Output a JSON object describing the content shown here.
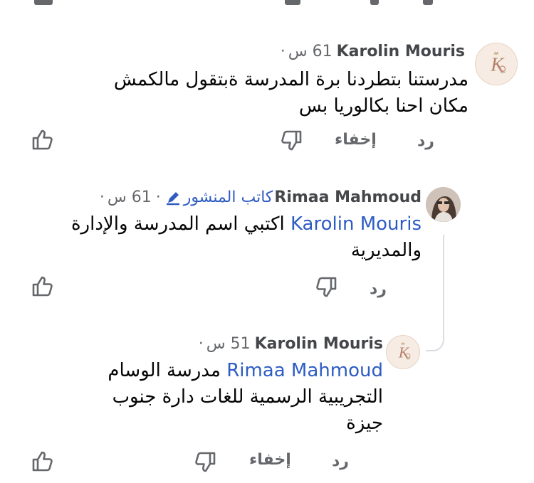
{
  "colors": {
    "text": "#050505",
    "name": "#444649",
    "meta": "#65676b",
    "mention": "#2d5cc4",
    "author_badge": "#2f5bc3",
    "thread_line": "#dadde1"
  },
  "comments": [
    {
      "author": "Karolin Mouris",
      "time": "61 س",
      "separator": "·",
      "text_lines": [
        "مدرستنا بتطردنا برة المدرسة ةبتقول مالكمش",
        "مكان احنا بكالوريا بس"
      ],
      "like_icon": "thumbs-up-icon",
      "dislike_icon": "thumbs-down-icon",
      "hide_label": "إخفاء",
      "reply_label": "رد"
    },
    {
      "author": "Rimaa Mahmoud",
      "author_badge_label": "كاتب المنشور",
      "author_badge_icon": "pencil-icon",
      "time": "61 س",
      "separator": "·",
      "mention": "Karolin Mouris",
      "text_line1": "اكتبي اسم المدرسة والإدارة",
      "text_line2": "والمديرية",
      "like_icon": "thumbs-up-icon",
      "dislike_icon": "thumbs-down-icon",
      "reply_label": "رد"
    },
    {
      "author": "Karolin Mouris",
      "time": "51 س",
      "separator": "·",
      "mention": "Rimaa Mahmoud",
      "text_line1": "مدرسة الوسام",
      "text_line2": "التجريبية الرسمية للغات دارة جنوب",
      "text_line3": "جيزة",
      "like_icon": "thumbs-up-icon",
      "dislike_icon": "thumbs-down-icon",
      "hide_label": "إخفاء",
      "reply_label": "رد"
    }
  ]
}
